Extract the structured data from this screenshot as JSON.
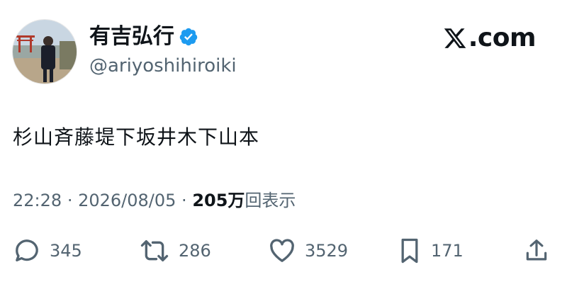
{
  "author": {
    "display_name": "有吉弘行",
    "handle": "@ariyoshihiroiki",
    "verified": true,
    "avatar_icon": "profile-photo"
  },
  "brand": {
    "icon": "x-logo-icon",
    "suffix": ".com"
  },
  "tweet": {
    "text": "杉山斉藤堤下坂井木下山本"
  },
  "meta": {
    "time": "22:28",
    "separator": "·",
    "date": "2026/08/05",
    "views_count": "205万",
    "views_label": "回表示"
  },
  "actions": {
    "reply": {
      "icon": "reply-icon",
      "count": "345"
    },
    "retweet": {
      "icon": "retweet-icon",
      "count": "286"
    },
    "like": {
      "icon": "heart-icon",
      "count": "3529"
    },
    "bookmark": {
      "icon": "bookmark-icon",
      "count": "171"
    },
    "share": {
      "icon": "share-icon"
    }
  },
  "colors": {
    "text_primary": "#0f1419",
    "text_secondary": "#536471",
    "verified_blue": "#1d9bf0"
  }
}
